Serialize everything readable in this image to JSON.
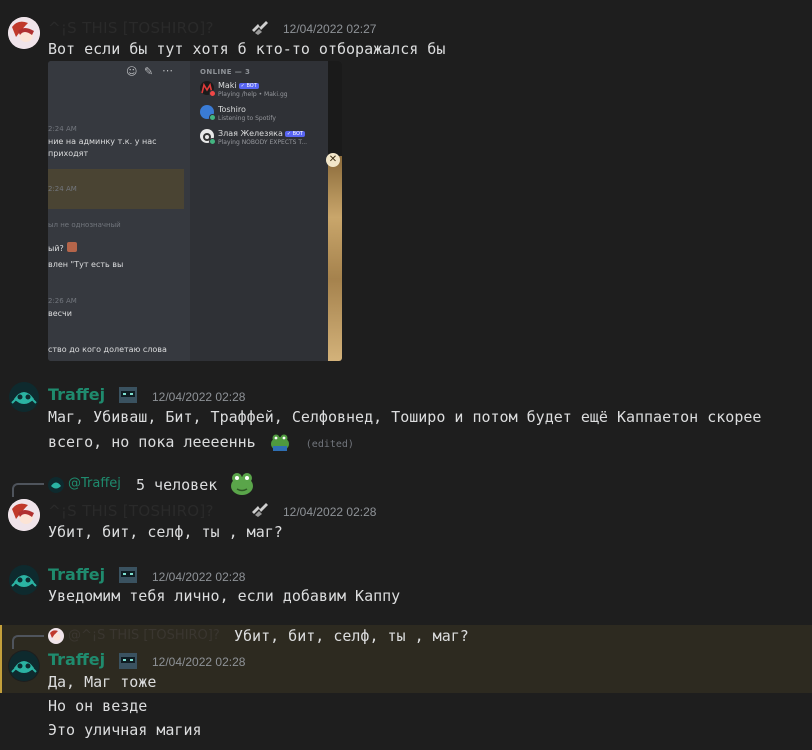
{
  "messages": [
    {
      "author": "^¡S THIS [TOSHIRO]?",
      "timestamp": "12/04/2022 02:27",
      "text": "Вот если бы тут хотя б кто-то отборажался бы",
      "embed": {
        "toolbar_icons": [
          "add-reaction-icon",
          "edit-icon",
          "more-icon"
        ],
        "chat_lines": [
          {
            "text": "2:24 AM",
            "kind": "time"
          },
          {
            "text": "ние на админку т.к. у нас",
            "kind": "text"
          },
          {
            "text": "приходят",
            "kind": "text"
          },
          {
            "text": "2:24 AM",
            "kind": "time"
          },
          {
            "text": "ыл не однозначный",
            "kind": "time"
          },
          {
            "text": "ый?",
            "kind": "text"
          },
          {
            "text": "влен \"Тут есть вы",
            "kind": "text"
          },
          {
            "text": "2:26 AM",
            "kind": "time"
          },
          {
            "text": "весчи",
            "kind": "text"
          },
          {
            "text": "ство до кого долетаю слова",
            "kind": "text"
          }
        ],
        "members_header": "ONLINE — 3",
        "members": [
          {
            "name": "Maki",
            "badge": "✓ BOT",
            "status": "Playing /help • Maki.gg",
            "color": "#e03a3a"
          },
          {
            "name": "Toshiro",
            "badge": "",
            "status": "Listening to Spotify",
            "color": "#3a7bd5"
          },
          {
            "name": "Злая Железяка",
            "badge": "✓ BOT",
            "status": "Playing NOBODY EXPECTS T...",
            "color": "#e8e8e8"
          }
        ],
        "close_glyph": "✕"
      }
    },
    {
      "author": "Traffej",
      "timestamp": "12/04/2022 02:28",
      "text_line1": "Маг, Убиваш, Бит, Траффей, Селфовнед, Тоширо и потом будет ещё Каппаетон скорее",
      "text_line2": "всего, но пока лееееннь",
      "edited": "(edited)"
    },
    {
      "reply_to": "@Traffej",
      "reply_text": "5 человек",
      "author": "^¡S THIS [TOSHIRO]?",
      "timestamp": "12/04/2022 02:28",
      "text": "Убит, бит, селф, ты , маг?"
    },
    {
      "author": "Traffej",
      "timestamp": "12/04/2022 02:28",
      "text": "Уведомим тебя лично, если добавим Каппу"
    },
    {
      "reply_to": "@^¡S THIS [TOSHIRO]?",
      "reply_text": "Убит, бит, селф, ты , маг?",
      "author": "Traffej",
      "timestamp": "12/04/2022 02:28",
      "lines": [
        "Да, Маг тоже",
        "Но он везде",
        "Это уличная магия"
      ]
    }
  ],
  "colors": {
    "background": "#1e1e1e",
    "teal_username": "#1f8b6e",
    "dim_username": "#2a2a2a",
    "highlight_bg": "#2d2a20",
    "highlight_border": "#c4a03b"
  }
}
